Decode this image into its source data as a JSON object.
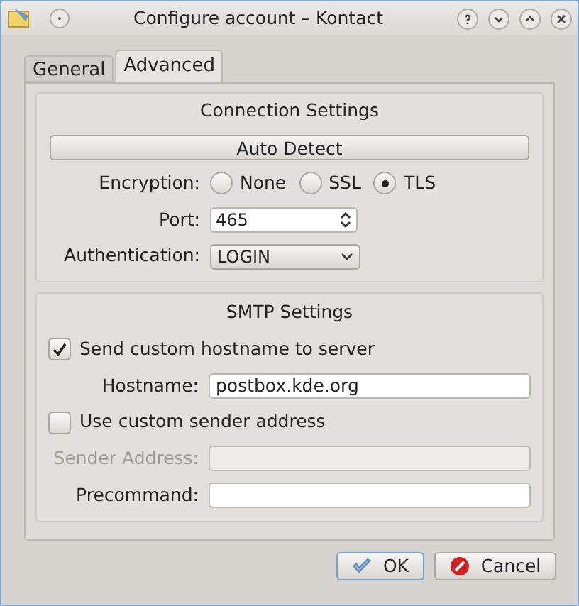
{
  "window": {
    "title": "Configure account – Kontact"
  },
  "tabs": [
    {
      "label": "General",
      "selected": false
    },
    {
      "label": "Advanced",
      "selected": true
    }
  ],
  "connection": {
    "title": "Connection Settings",
    "auto_detect": "Auto Detect",
    "encryption": {
      "label": "Encryption:",
      "options": [
        {
          "label": "None",
          "selected": false
        },
        {
          "label": "SSL",
          "selected": false
        },
        {
          "label": "TLS",
          "selected": true
        }
      ]
    },
    "port": {
      "label": "Port:",
      "value": "465"
    },
    "authentication": {
      "label": "Authentication:",
      "value": "LOGIN"
    }
  },
  "smtp": {
    "title": "SMTP Settings",
    "send_hostname": {
      "label": "Send custom hostname to server",
      "checked": true
    },
    "hostname": {
      "label": "Hostname:",
      "value": "postbox.kde.org",
      "disabled": false
    },
    "custom_sender": {
      "label": "Use custom sender address",
      "checked": false
    },
    "sender_address": {
      "label": "Sender Address:",
      "disabled": true
    },
    "precommand": {
      "label": "Precommand:",
      "disabled": false
    }
  },
  "buttons": [
    {
      "label": "OK",
      "kind": "ok"
    },
    {
      "label": "Cancel",
      "kind": "cancel"
    }
  ]
}
